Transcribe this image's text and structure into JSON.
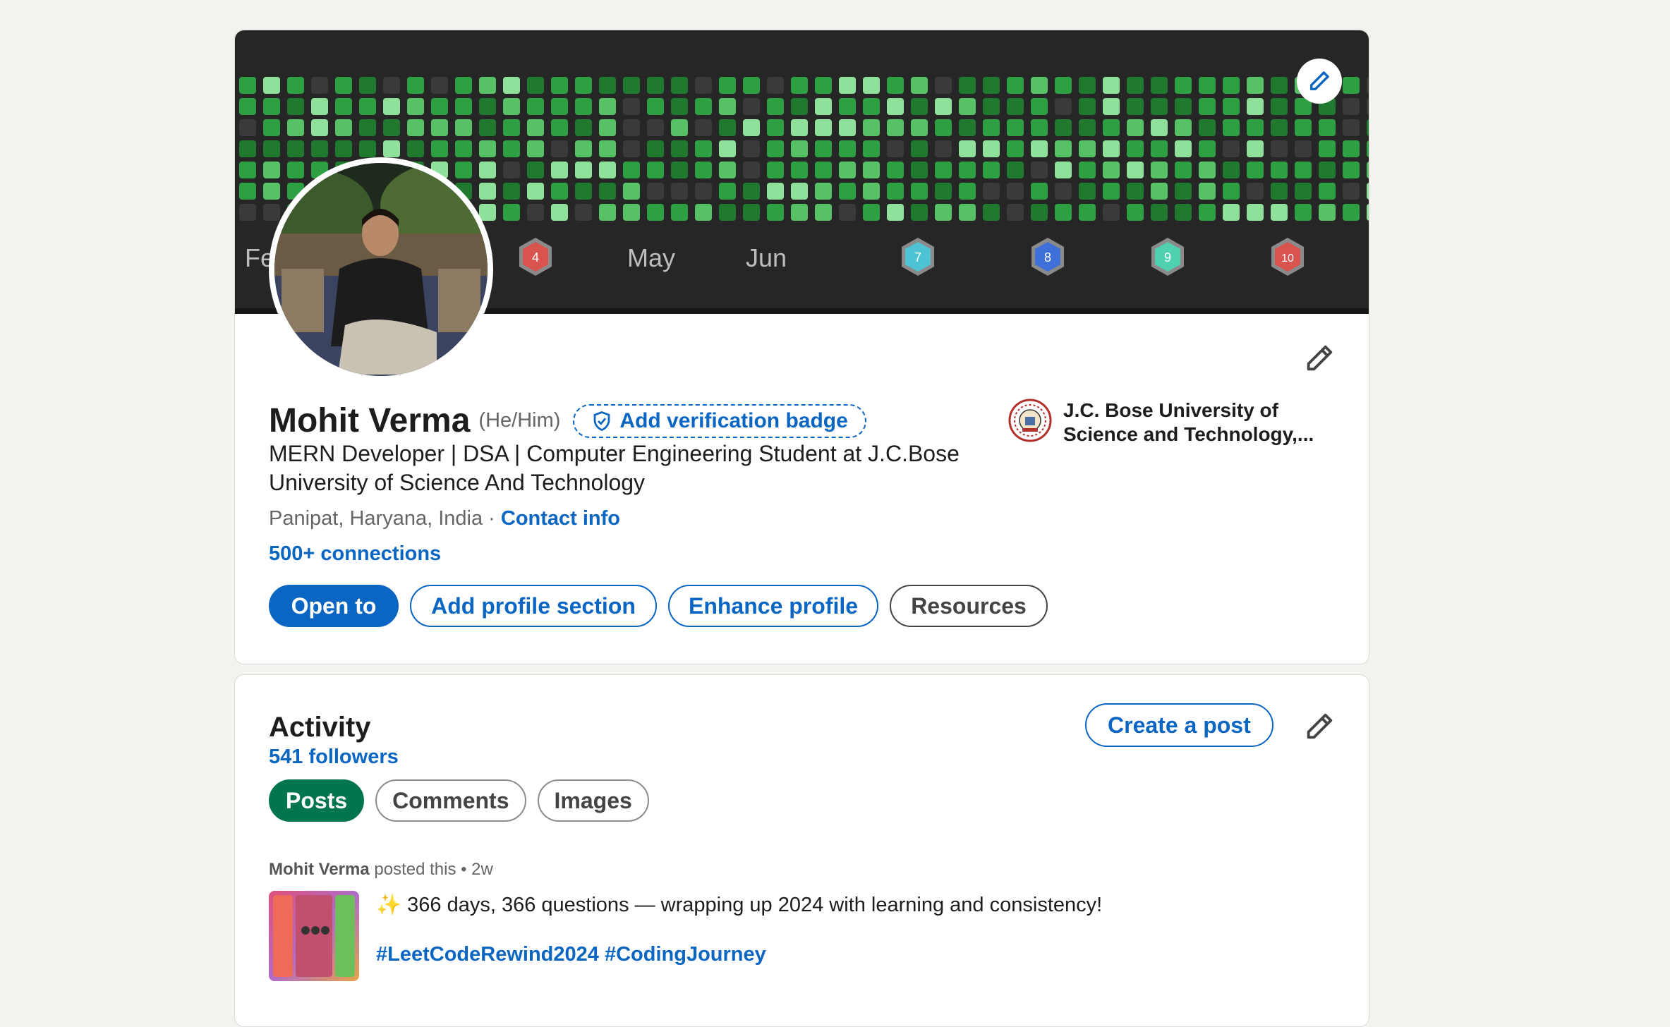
{
  "banner": {
    "months": [
      "Fe",
      "May",
      "Jun"
    ],
    "badges": [
      {
        "number": "4",
        "color": "#d9534f"
      },
      {
        "number": "7",
        "color": "#4ec3d6"
      },
      {
        "number": "8",
        "color": "#3f6fd8"
      },
      {
        "number": "9",
        "color": "#4fd1b0"
      },
      {
        "number": "10",
        "color": "#d9534f"
      }
    ],
    "edit_icon": "pencil-icon",
    "colors": {
      "background": "#262626",
      "empty": "#3a3a3a",
      "level1": "#1f7a2f",
      "level2": "#2ea043",
      "level3": "#56c165",
      "level4": "#8fe09a"
    }
  },
  "profile": {
    "name": "Mohit Verma",
    "pronouns": "(He/Him)",
    "verification_label": "Add verification badge",
    "headline": "MERN Developer | DSA | Computer Engineering Student at J.C.Bose University of Science And Technology",
    "location": "Panipat, Haryana, India",
    "separator": " · ",
    "contact_label": "Contact info",
    "connections": "500+ connections",
    "school_name": "J.C. Bose University of Science and Technology,...",
    "buttons": {
      "open_to": "Open to",
      "add_section": "Add profile section",
      "enhance": "Enhance profile",
      "resources": "Resources"
    }
  },
  "activity": {
    "title": "Activity",
    "followers": "541 followers",
    "create_post": "Create a post",
    "filters": [
      "Posts",
      "Comments",
      "Images"
    ],
    "post": {
      "author": "Mohit Verma",
      "action": " posted this • 2w",
      "text": "✨ 366 days, 366 questions — wrapping up 2024 with learning and consistency!",
      "tags": [
        "#LeetCodeRewind2024",
        "#CodingJourney"
      ]
    }
  },
  "accent": "#0a66c2"
}
